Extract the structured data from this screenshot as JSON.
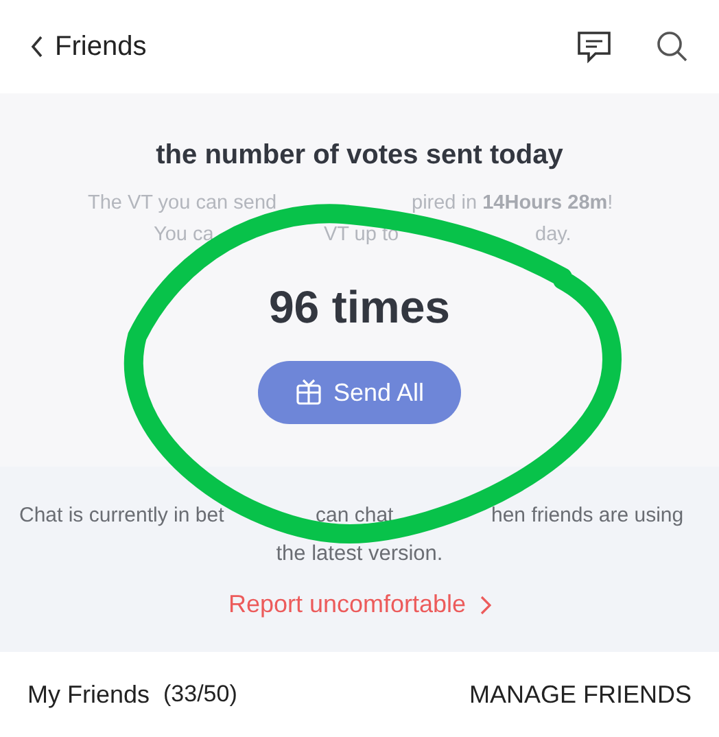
{
  "header": {
    "title": "Friends"
  },
  "votes": {
    "title": "the number of votes sent today",
    "notice_lines": [
      [
        "The VT you can send",
        "pired in **14Hours 28m**!"
      ],
      [
        "You ca",
        "VT up to",
        "day."
      ]
    ],
    "count": "96 times",
    "button": "Send All"
  },
  "chat_notice": {
    "line_1": [
      "Chat is currently in bet",
      "can chat",
      "hen friends are using"
    ],
    "line_2": "the latest version.",
    "report_link": "Report uncomfortable"
  },
  "friends_bar": {
    "label": "My Friends",
    "count": "(33/50)",
    "action": "MANAGE FRIENDS"
  }
}
